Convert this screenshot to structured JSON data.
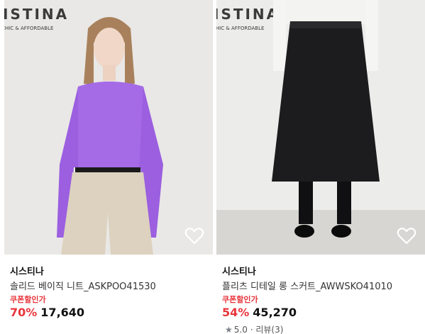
{
  "products": [
    {
      "photo_logo": "ISTINA",
      "photo_tagline": "CHIC & AFFORDABLE",
      "brand": "시스티나",
      "name": "솔리드 베이직 니트_ASKPOO41530",
      "coupon_label": "쿠폰할인가",
      "discount": "70%",
      "price": "17,640",
      "wishlist_icon": "heart-outline-icon"
    },
    {
      "photo_logo": "ISTINA",
      "photo_tagline": "CHIC & AFFORDABLE",
      "brand": "시스티나",
      "name": "플리츠 디테일 롱 스커트_AWWSKO41010",
      "coupon_label": "쿠폰할인가",
      "discount": "54%",
      "price": "45,270",
      "rating_icon": "star-icon",
      "rating_score": "5.0",
      "rating_separator": "·",
      "review_label": "리뷰(3)",
      "wishlist_icon": "heart-outline-icon"
    }
  ],
  "colors": {
    "discount_red": "#e8353b",
    "sweater_purple": "#9b5fe0",
    "skirt_black": "#1c1c1e"
  }
}
